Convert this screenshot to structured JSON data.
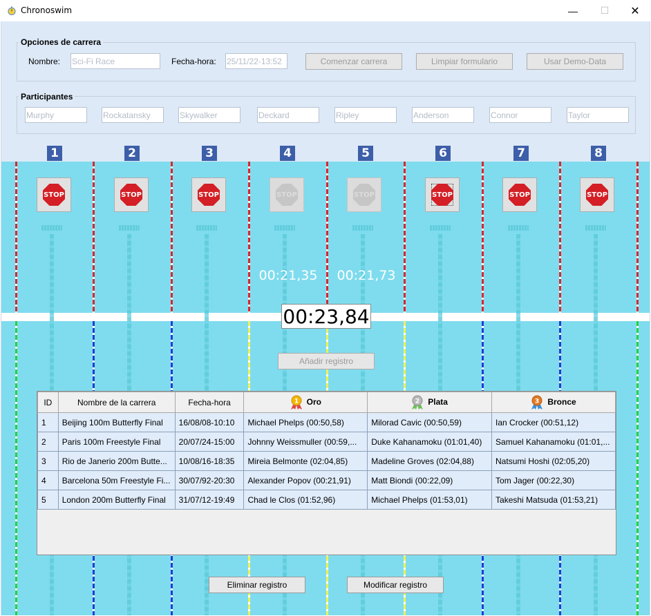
{
  "window": {
    "title": "Chronoswim",
    "minimize": "—",
    "maximize": "☐",
    "close": "✕"
  },
  "race_options": {
    "title": "Opciones de carrera",
    "name_label": "Nombre:",
    "name_value": "Sci-Fi Race",
    "datetime_label": "Fecha-hora:",
    "datetime_value": "25/11/22-13:52",
    "start_button": "Comenzar carrera",
    "clear_button": "Limpiar formulario",
    "demo_button": "Usar Demo-Data"
  },
  "participants": {
    "title": "Participantes",
    "names": [
      "Murphy",
      "Rockatansky",
      "Skywalker",
      "Deckard",
      "Ripley",
      "Anderson",
      "Connor",
      "Taylor"
    ]
  },
  "lanes": [
    {
      "number": "1",
      "stop_label": "STOP",
      "stop_enabled": true,
      "time": ""
    },
    {
      "number": "2",
      "stop_label": "STOP",
      "stop_enabled": true,
      "time": ""
    },
    {
      "number": "3",
      "stop_label": "STOP",
      "stop_enabled": true,
      "time": ""
    },
    {
      "number": "4",
      "stop_label": "STOP",
      "stop_enabled": false,
      "time": "00:21,35"
    },
    {
      "number": "5",
      "stop_label": "STOP",
      "stop_enabled": false,
      "time": "00:21,73"
    },
    {
      "number": "6",
      "stop_label": "STOP",
      "stop_enabled": true,
      "time": ""
    },
    {
      "number": "7",
      "stop_label": "STOP",
      "stop_enabled": true,
      "time": ""
    },
    {
      "number": "8",
      "stop_label": "STOP",
      "stop_enabled": true,
      "time": ""
    }
  ],
  "main_clock": "00:23,84",
  "add_record_button": "Añadir registro",
  "table": {
    "headers": {
      "id": "ID",
      "name": "Nombre de la carrera",
      "datetime": "Fecha-hora",
      "gold": "Oro",
      "silver": "Plata",
      "bronze": "Bronce"
    },
    "medal_numbers": {
      "gold": "1",
      "silver": "2",
      "bronze": "3"
    },
    "rows": [
      [
        "1",
        "Beijing 100m Butterfly Final",
        "16/08/08-10:10",
        "Michael Phelps (00:50,58)",
        "Milorad Cavic (00:50,59)",
        "Ian Crocker (00:51,12)"
      ],
      [
        "2",
        "Paris 100m Freestyle Final",
        "20/07/24-15:00",
        "Johnny Weissmuller (00:59,...",
        "Duke Kahanamoku (01:01,40)",
        "Samuel Kahanamoku (01:01,..."
      ],
      [
        "3",
        "Rio de Janerio 200m Butte...",
        "10/08/16-18:35",
        "Mireia Belmonte (02:04,85)",
        "Madeline Groves (02:04,88)",
        "Natsumi Hoshi (02:05,20)"
      ],
      [
        "4",
        "Barcelona 50m Freestyle Fi...",
        "30/07/92-20:30",
        "Alexander Popov (00:21,91)",
        "Matt Biondi (00:22,09)",
        "Tom Jager (00:22,30)"
      ],
      [
        "5",
        "London 200m Butterfly Final",
        "31/07/12-19:49",
        "Chad le Clos (01:52,96)",
        "Michael Phelps (01:53,01)",
        "Takeshi Matsuda (01:53,21)"
      ]
    ]
  },
  "delete_button": "Eliminar registro",
  "modify_button": "Modificar registro",
  "colors": {
    "pool": "#7fdcee",
    "background": "#dde9f7",
    "lane_red": "#d8282f",
    "lane_blue": "#1d3fd6",
    "lane_yellow": "#f2ef55",
    "lane_green": "#27d23a",
    "lane_badge": "#3d5ea8",
    "row_bg": "#e0ecfa"
  },
  "icons": {
    "app": "stopwatch-icon",
    "stop": "stop-sign-icon",
    "gold": "gold-medal-icon",
    "silver": "silver-medal-icon",
    "bronze": "bronze-medal-icon"
  }
}
